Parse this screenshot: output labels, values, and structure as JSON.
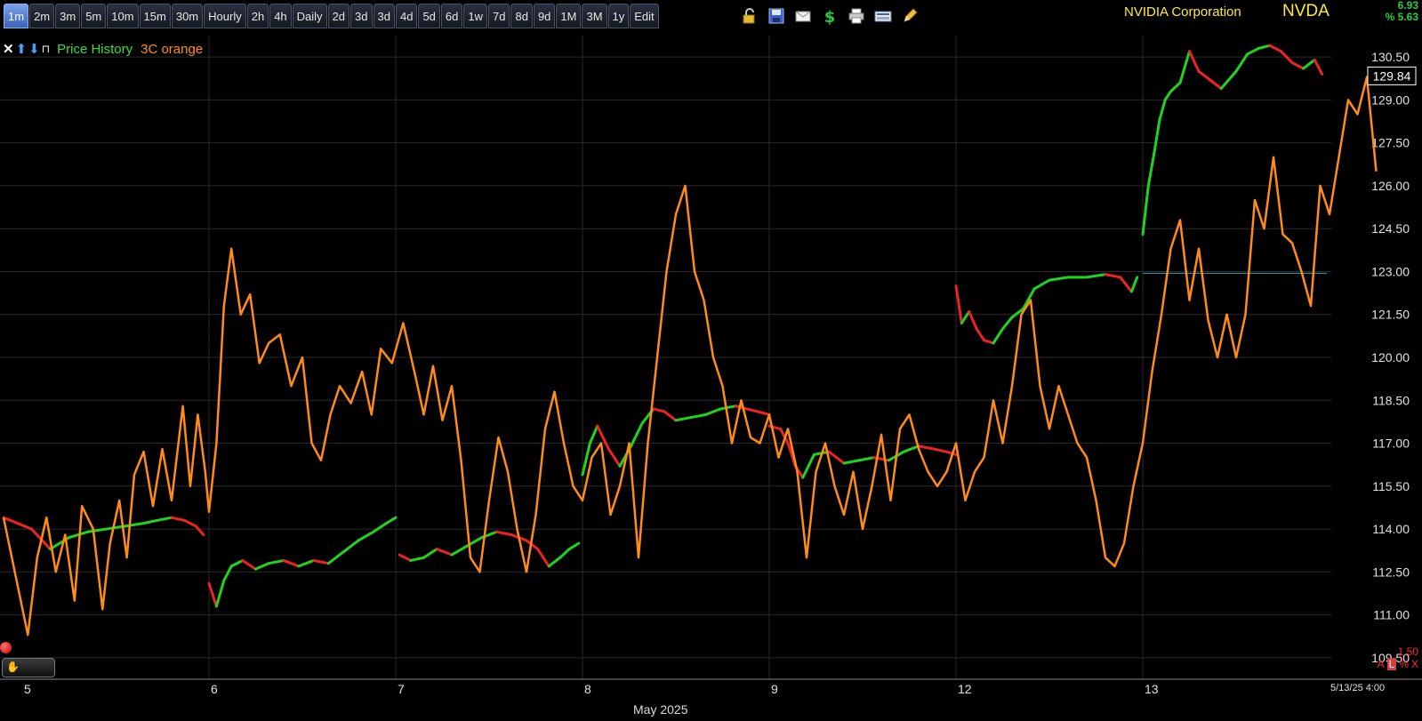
{
  "toolbar": {
    "timeframes": [
      "1m",
      "2m",
      "3m",
      "5m",
      "10m",
      "15m",
      "30m",
      "Hourly",
      "2h",
      "4h",
      "Daily",
      "2d",
      "3d",
      "3d",
      "4d",
      "5d",
      "6d",
      "1w",
      "7d",
      "8d",
      "9d",
      "1M",
      "3M",
      "1y",
      "Edit"
    ],
    "active": "1m",
    "tool_icons": [
      "unlock-icon",
      "save-icon",
      "mail-icon",
      "dollar-icon",
      "print-icon",
      "keyboard-icon",
      "pencil-icon"
    ]
  },
  "header": {
    "company": "NVIDIA Corporation",
    "ticker": "NVDA",
    "change": "6.93",
    "change_pct": "% 5.63"
  },
  "legend": {
    "icons": [
      "✕",
      "⬆",
      "⬇",
      "⊓"
    ],
    "price_label": "Price History",
    "indicator_label": "3C orange"
  },
  "footer": {
    "indicator_value": "1.50",
    "axis_icons": [
      "A",
      "L",
      "%",
      "X"
    ],
    "last_date": "5/13/25 4:00",
    "month": "May 2025"
  },
  "colors": {
    "price_up": "#1fd41f",
    "price_down": "#ee2222",
    "indicator": "#ff8c1a",
    "ref_line": "#2aa9b4",
    "grid": "#2a2a2a",
    "axis_text": "#e0e0e0",
    "current_box": "#ffffff"
  },
  "chart_data": {
    "type": "line",
    "title": "",
    "xlabel": "",
    "ylabel": "",
    "ylim": [
      108.75,
      131.25
    ],
    "y_ticks": [
      130.5,
      129.0,
      127.5,
      126.0,
      124.5,
      123.0,
      121.5,
      120.0,
      118.5,
      117.0,
      115.5,
      114.0,
      112.5,
      111.0,
      109.5
    ],
    "x_ticks": [
      "5",
      "6",
      "7",
      "8",
      "9",
      "12",
      "13"
    ],
    "current_price": 129.84,
    "reference_price": 122.94,
    "days": [
      {
        "label": "5",
        "start": 0,
        "end": 1
      },
      {
        "label": "6",
        "start": 1,
        "end": 2
      },
      {
        "label": "7",
        "start": 2,
        "end": 3
      },
      {
        "label": "8",
        "start": 3,
        "end": 4
      },
      {
        "label": "9",
        "start": 4,
        "end": 5
      },
      {
        "label": "12",
        "start": 5,
        "end": 6
      },
      {
        "label": "13",
        "start": 6,
        "end": 7
      }
    ],
    "series": [
      {
        "name": "Price History",
        "segments": [
          [
            [
              -0.1,
              114.4
            ],
            [
              0.05,
              114.0
            ],
            [
              0.15,
              113.3
            ],
            [
              0.25,
              113.7
            ],
            [
              0.35,
              113.9
            ],
            [
              0.45,
              114.0
            ],
            [
              0.55,
              114.1
            ],
            [
              0.65,
              114.2
            ],
            [
              0.72,
              114.3
            ],
            [
              0.8,
              114.4
            ],
            [
              0.87,
              114.3
            ],
            [
              0.93,
              114.1
            ],
            [
              0.97,
              113.8
            ]
          ],
          [
            [
              1.0,
              112.1
            ],
            [
              1.04,
              111.3
            ],
            [
              1.08,
              112.2
            ],
            [
              1.12,
              112.7
            ],
            [
              1.18,
              112.9
            ],
            [
              1.25,
              112.6
            ],
            [
              1.32,
              112.8
            ],
            [
              1.4,
              112.9
            ],
            [
              1.48,
              112.7
            ],
            [
              1.56,
              112.9
            ],
            [
              1.64,
              112.8
            ],
            [
              1.72,
              113.2
            ],
            [
              1.8,
              113.6
            ],
            [
              1.88,
              113.9
            ],
            [
              1.95,
              114.2
            ],
            [
              2.0,
              114.4
            ]
          ],
          [
            [
              2.02,
              113.1
            ],
            [
              2.08,
              112.9
            ],
            [
              2.15,
              113.0
            ],
            [
              2.22,
              113.3
            ],
            [
              2.3,
              113.1
            ],
            [
              2.38,
              113.4
            ],
            [
              2.46,
              113.7
            ],
            [
              2.54,
              113.9
            ],
            [
              2.62,
              113.8
            ],
            [
              2.7,
              113.6
            ],
            [
              2.76,
              113.3
            ],
            [
              2.82,
              112.7
            ],
            [
              2.88,
              113.0
            ],
            [
              2.93,
              113.3
            ],
            [
              2.98,
              113.5
            ]
          ],
          [
            [
              3.0,
              115.9
            ],
            [
              3.04,
              117.0
            ],
            [
              3.08,
              117.6
            ],
            [
              3.14,
              116.8
            ],
            [
              3.2,
              116.2
            ],
            [
              3.26,
              116.9
            ],
            [
              3.32,
              117.7
            ],
            [
              3.38,
              118.2
            ],
            [
              3.44,
              118.1
            ],
            [
              3.5,
              117.8
            ],
            [
              3.58,
              117.9
            ],
            [
              3.66,
              118.0
            ],
            [
              3.74,
              118.2
            ],
            [
              3.82,
              118.3
            ],
            [
              3.88,
              118.2
            ],
            [
              3.94,
              118.1
            ],
            [
              4.0,
              118.0
            ]
          ],
          [
            [
              4.0,
              117.6
            ],
            [
              4.06,
              117.5
            ],
            [
              4.1,
              117.0
            ],
            [
              4.14,
              116.2
            ],
            [
              4.18,
              115.8
            ],
            [
              4.24,
              116.6
            ],
            [
              4.32,
              116.7
            ],
            [
              4.4,
              116.3
            ],
            [
              4.48,
              116.4
            ],
            [
              4.56,
              116.5
            ],
            [
              4.64,
              116.4
            ],
            [
              4.72,
              116.7
            ],
            [
              4.8,
              116.9
            ],
            [
              4.88,
              116.8
            ],
            [
              4.95,
              116.7
            ],
            [
              5.0,
              116.6
            ]
          ],
          [
            [
              5.0,
              122.5
            ],
            [
              5.03,
              121.2
            ],
            [
              5.07,
              121.6
            ],
            [
              5.11,
              121.0
            ],
            [
              5.15,
              120.6
            ],
            [
              5.2,
              120.5
            ],
            [
              5.25,
              121.0
            ],
            [
              5.3,
              121.4
            ],
            [
              5.36,
              121.7
            ],
            [
              5.42,
              122.4
            ],
            [
              5.5,
              122.7
            ],
            [
              5.6,
              122.8
            ],
            [
              5.7,
              122.8
            ],
            [
              5.8,
              122.9
            ],
            [
              5.88,
              122.8
            ],
            [
              5.94,
              122.3
            ],
            [
              5.97,
              122.8
            ]
          ],
          [
            [
              6.0,
              124.3
            ],
            [
              6.03,
              126.0
            ],
            [
              6.06,
              127.1
            ],
            [
              6.09,
              128.3
            ],
            [
              6.12,
              129.0
            ],
            [
              6.15,
              129.3
            ],
            [
              6.2,
              129.6
            ],
            [
              6.25,
              130.7
            ],
            [
              6.3,
              130.0
            ],
            [
              6.36,
              129.7
            ],
            [
              6.42,
              129.4
            ],
            [
              6.5,
              130.0
            ],
            [
              6.56,
              130.6
            ],
            [
              6.62,
              130.8
            ],
            [
              6.68,
              130.9
            ],
            [
              6.74,
              130.7
            ],
            [
              6.8,
              130.3
            ],
            [
              6.86,
              130.1
            ],
            [
              6.92,
              130.4
            ],
            [
              6.96,
              129.9
            ]
          ]
        ]
      },
      {
        "name": "3C orange",
        "points": [
          [
            -0.1,
            114.4
          ],
          [
            0.03,
            110.3
          ],
          [
            0.08,
            113.0
          ],
          [
            0.13,
            114.4
          ],
          [
            0.18,
            112.5
          ],
          [
            0.23,
            113.8
          ],
          [
            0.28,
            111.5
          ],
          [
            0.32,
            114.8
          ],
          [
            0.38,
            114.0
          ],
          [
            0.43,
            111.2
          ],
          [
            0.47,
            113.5
          ],
          [
            0.52,
            115.0
          ],
          [
            0.56,
            113.0
          ],
          [
            0.6,
            115.9
          ],
          [
            0.65,
            116.7
          ],
          [
            0.7,
            114.8
          ],
          [
            0.75,
            116.8
          ],
          [
            0.8,
            115.0
          ],
          [
            0.86,
            118.3
          ],
          [
            0.9,
            115.5
          ],
          [
            0.94,
            118.0
          ],
          [
            0.98,
            116.0
          ],
          [
            1.0,
            114.6
          ],
          [
            1.04,
            117.0
          ],
          [
            1.08,
            121.8
          ],
          [
            1.12,
            123.8
          ],
          [
            1.17,
            121.5
          ],
          [
            1.22,
            122.2
          ],
          [
            1.27,
            119.8
          ],
          [
            1.32,
            120.5
          ],
          [
            1.38,
            120.8
          ],
          [
            1.44,
            119.0
          ],
          [
            1.5,
            120.0
          ],
          [
            1.55,
            117.0
          ],
          [
            1.6,
            116.4
          ],
          [
            1.65,
            118.0
          ],
          [
            1.7,
            119.0
          ],
          [
            1.76,
            118.4
          ],
          [
            1.82,
            119.5
          ],
          [
            1.87,
            118.0
          ],
          [
            1.92,
            120.3
          ],
          [
            1.98,
            119.8
          ],
          [
            2.04,
            121.2
          ],
          [
            2.1,
            119.5
          ],
          [
            2.15,
            118.0
          ],
          [
            2.2,
            119.7
          ],
          [
            2.25,
            117.8
          ],
          [
            2.3,
            119.0
          ],
          [
            2.35,
            116.4
          ],
          [
            2.4,
            113.0
          ],
          [
            2.45,
            112.5
          ],
          [
            2.5,
            115.0
          ],
          [
            2.55,
            117.2
          ],
          [
            2.6,
            116.0
          ],
          [
            2.65,
            114.0
          ],
          [
            2.7,
            112.5
          ],
          [
            2.75,
            114.5
          ],
          [
            2.8,
            117.5
          ],
          [
            2.85,
            118.8
          ],
          [
            2.9,
            117.0
          ],
          [
            2.95,
            115.5
          ],
          [
            3.0,
            115.0
          ],
          [
            3.05,
            116.5
          ],
          [
            3.1,
            117.0
          ],
          [
            3.15,
            114.5
          ],
          [
            3.2,
            115.5
          ],
          [
            3.25,
            117.0
          ],
          [
            3.3,
            113.0
          ],
          [
            3.35,
            117.0
          ],
          [
            3.4,
            120.0
          ],
          [
            3.45,
            123.0
          ],
          [
            3.5,
            125.0
          ],
          [
            3.55,
            126.0
          ],
          [
            3.6,
            123.0
          ],
          [
            3.65,
            122.0
          ],
          [
            3.7,
            120.0
          ],
          [
            3.75,
            119.0
          ],
          [
            3.8,
            117.0
          ],
          [
            3.85,
            118.5
          ],
          [
            3.9,
            117.2
          ],
          [
            3.95,
            117.0
          ],
          [
            4.0,
            118.0
          ],
          [
            4.05,
            116.5
          ],
          [
            4.1,
            117.5
          ],
          [
            4.15,
            116.0
          ],
          [
            4.2,
            113.0
          ],
          [
            4.25,
            116.0
          ],
          [
            4.3,
            117.0
          ],
          [
            4.35,
            115.5
          ],
          [
            4.4,
            114.5
          ],
          [
            4.45,
            116.0
          ],
          [
            4.5,
            114.0
          ],
          [
            4.55,
            115.5
          ],
          [
            4.6,
            117.3
          ],
          [
            4.65,
            115.0
          ],
          [
            4.7,
            117.5
          ],
          [
            4.75,
            118.0
          ],
          [
            4.8,
            116.8
          ],
          [
            4.85,
            116.0
          ],
          [
            4.9,
            115.5
          ],
          [
            4.95,
            116.0
          ],
          [
            5.0,
            117.0
          ],
          [
            5.05,
            115.0
          ],
          [
            5.1,
            116.0
          ],
          [
            5.15,
            116.5
          ],
          [
            5.2,
            118.5
          ],
          [
            5.25,
            117.0
          ],
          [
            5.3,
            119.0
          ],
          [
            5.35,
            121.5
          ],
          [
            5.4,
            122.0
          ],
          [
            5.45,
            119.0
          ],
          [
            5.5,
            117.5
          ],
          [
            5.55,
            119.0
          ],
          [
            5.6,
            118.0
          ],
          [
            5.65,
            117.0
          ],
          [
            5.7,
            116.5
          ],
          [
            5.75,
            115.0
          ],
          [
            5.8,
            113.0
          ],
          [
            5.85,
            112.7
          ],
          [
            5.9,
            113.5
          ],
          [
            5.95,
            115.5
          ],
          [
            6.0,
            117.0
          ],
          [
            6.05,
            119.5
          ],
          [
            6.1,
            121.5
          ],
          [
            6.15,
            123.8
          ],
          [
            6.2,
            124.8
          ],
          [
            6.25,
            122.0
          ],
          [
            6.3,
            123.8
          ],
          [
            6.35,
            121.3
          ],
          [
            6.4,
            120.0
          ],
          [
            6.45,
            121.5
          ],
          [
            6.5,
            120.0
          ],
          [
            6.55,
            121.5
          ],
          [
            6.6,
            125.5
          ],
          [
            6.65,
            124.5
          ],
          [
            6.7,
            127.0
          ],
          [
            6.75,
            124.3
          ],
          [
            6.8,
            124.0
          ],
          [
            6.85,
            123.0
          ],
          [
            6.9,
            121.8
          ],
          [
            6.95,
            126.0
          ],
          [
            7.0,
            125.0
          ],
          [
            7.05,
            127.0
          ],
          [
            7.1,
            129.0
          ],
          [
            7.15,
            128.5
          ],
          [
            7.2,
            129.8
          ],
          [
            7.25,
            126.5
          ]
        ]
      }
    ]
  }
}
